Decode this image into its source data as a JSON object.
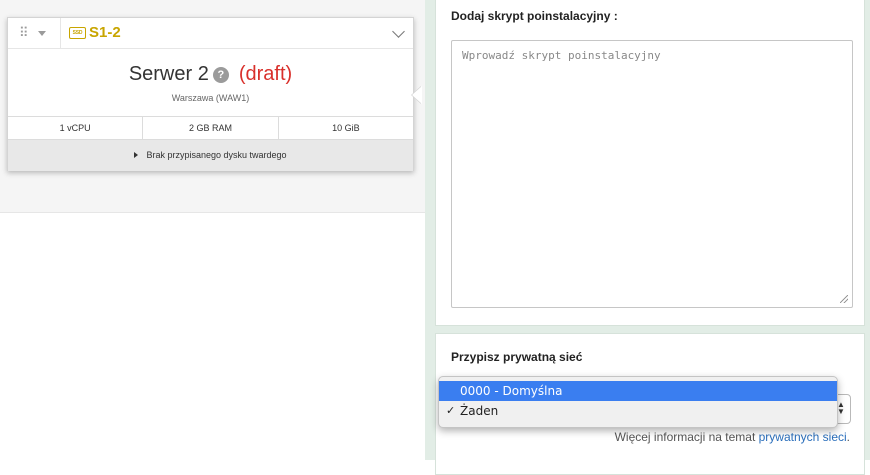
{
  "server_card": {
    "plan": "S1-2",
    "ssd_badge": "SSD",
    "name": "Serwer 2",
    "help_glyph": "?",
    "status": "(draft)",
    "location": "Warszawa (WAW1)",
    "specs": {
      "cpu": "1 vCPU",
      "ram": "2 GB RAM",
      "disk": "10 GiB"
    },
    "disk_notice": "Brak przypisanego dysku twardego"
  },
  "script_panel": {
    "label": "Dodaj skrypt poinstalacyjny :",
    "placeholder": "Wprowadź skrypt poinstalacyjny"
  },
  "network_panel": {
    "label": "Przypisz prywatną sieć",
    "more_info_prefix": "Więcej informacji na temat ",
    "more_info_link": "prywatnych sieci",
    "more_info_suffix": "."
  },
  "dropdown": {
    "options": [
      "0000 - Domyślna",
      "Żaden"
    ],
    "highlighted": "0000 - Domyślna",
    "selected": "Żaden",
    "check_glyph": "✓"
  },
  "colors": {
    "accent_gold": "#c8a500",
    "draft_red": "#d9302b",
    "link_blue": "#2a6ebb",
    "highlight_blue": "#3a7ef0"
  }
}
